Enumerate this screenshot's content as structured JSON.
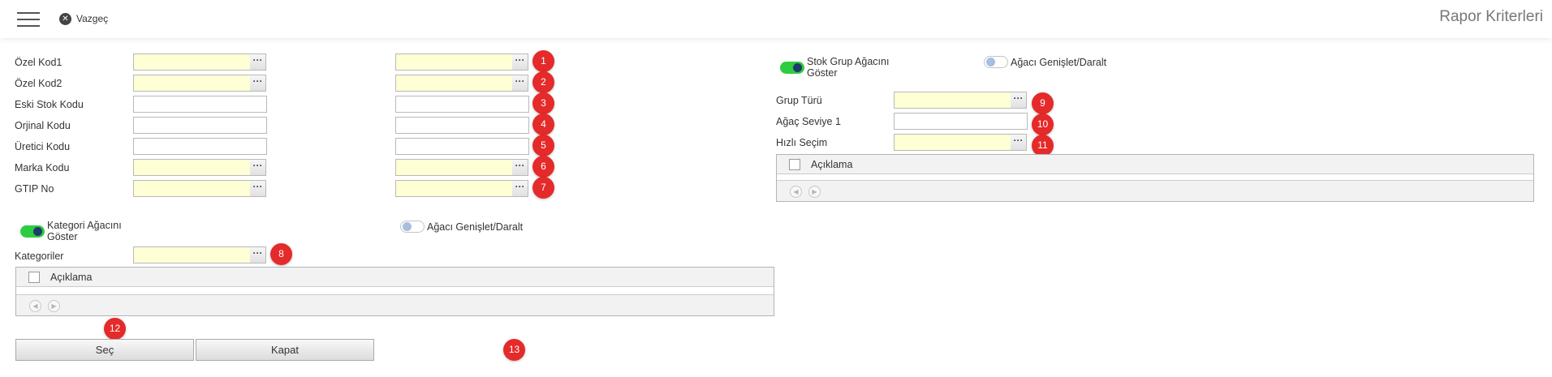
{
  "header": {
    "cancel_label": "Vazgeç",
    "title": "Rapor Kriterleri"
  },
  "criteria": {
    "rows": [
      {
        "label": "Özel Kod1",
        "badge": "1"
      },
      {
        "label": "Özel Kod2",
        "badge": "2"
      },
      {
        "label": "Eski Stok Kodu",
        "badge": "3"
      },
      {
        "label": "Orjinal Kodu",
        "badge": "4"
      },
      {
        "label": "Üretici Kodu",
        "badge": "5"
      },
      {
        "label": "Marka Kodu",
        "badge": "6"
      },
      {
        "label": "GTIP No",
        "badge": "7"
      }
    ]
  },
  "category": {
    "toggle_label_line1": "Kategori Ağacını",
    "toggle_label_line2": "Göster",
    "expand_label": "Ağacı Genişlet/Daralt",
    "field_label": "Kategoriler",
    "badge": "8",
    "grid_column": "Açıklama"
  },
  "stock_group": {
    "toggle_label_line1": "Stok Grup Ağacını",
    "toggle_label_line2": "Göster",
    "expand_label": "Ağacı Genişlet/Daralt",
    "fields": [
      {
        "label": "Grup Türü",
        "badge": "9"
      },
      {
        "label": "Ağaç Seviye 1",
        "badge": "10"
      },
      {
        "label": "Hızlı Seçim",
        "badge": "11"
      }
    ],
    "grid_column": "Açıklama"
  },
  "actions": {
    "select_label": "Seç",
    "select_badge": "12",
    "close_label": "Kapat",
    "close_badge": "13"
  },
  "colors": {
    "badge": "#e52a2a",
    "toggle_on": "#2ecc40",
    "field_highlight": "#ffffd6"
  },
  "icons": {
    "menu": "hamburger-menu-icon",
    "cancel": "close-circle-icon",
    "lookup": "ellipsis-icon",
    "pager_prev": "chevron-left-icon",
    "pager_next": "chevron-right-icon"
  }
}
